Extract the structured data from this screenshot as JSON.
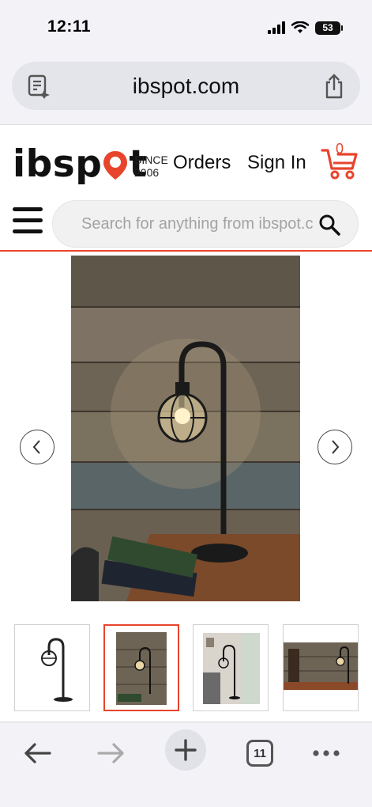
{
  "status": {
    "time": "12:11",
    "battery": "53"
  },
  "browser": {
    "url": "ibspot.com"
  },
  "site": {
    "logo_text_pre": "ibsp",
    "logo_text_post": "t",
    "since_line1": "SINCE",
    "since_line2": "2006",
    "orders_label": "Orders",
    "signin_label": "Sign In",
    "cart_count": "0",
    "search_placeholder": "Search for anything from ibspot.c"
  },
  "gallery": {
    "thumbnails": [
      "thumb-1",
      "thumb-2",
      "thumb-3",
      "thumb-4"
    ],
    "active_index": 1
  },
  "toolbar": {
    "tabs_count": "11"
  },
  "colors": {
    "accent": "#e8442c",
    "chrome": "#f2f2f7",
    "pill": "#e3e5ea"
  }
}
